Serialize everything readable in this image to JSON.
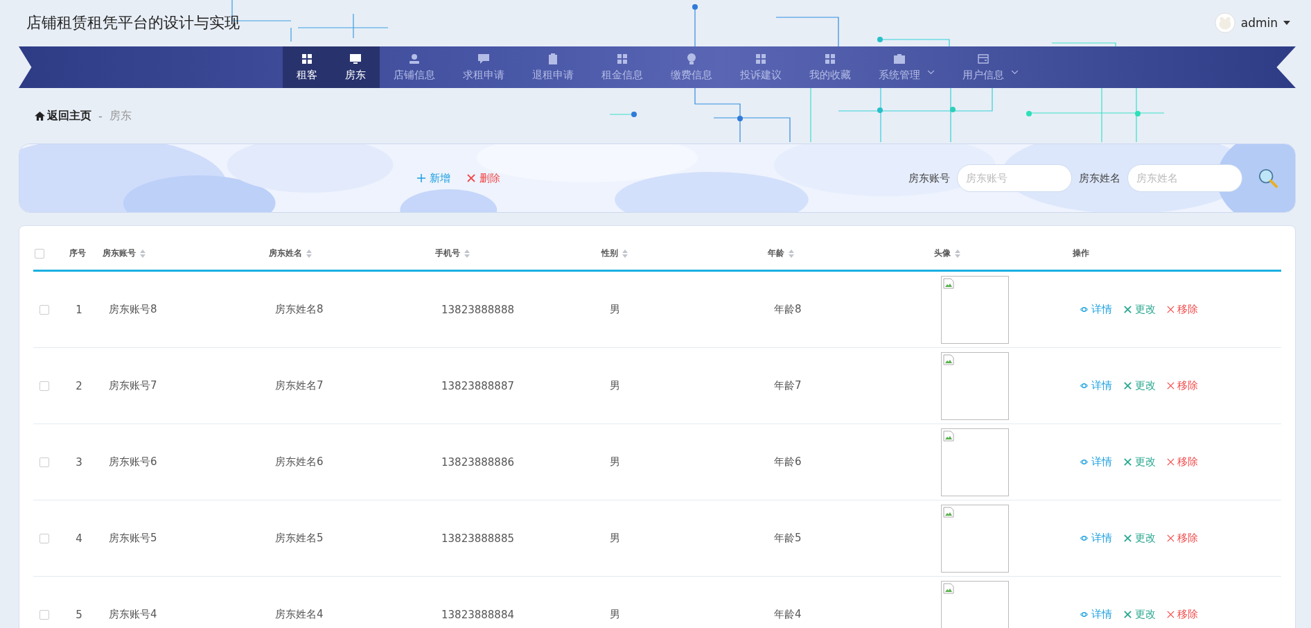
{
  "header": {
    "title": "店铺租赁租凭平台的设计与实现",
    "user": {
      "name": "admin"
    }
  },
  "nav": [
    {
      "label": "租客",
      "kind": "grid",
      "selected": true,
      "has_dropdown": false
    },
    {
      "label": "房东",
      "kind": "monitor",
      "selected": true,
      "has_dropdown": false
    },
    {
      "label": "店铺信息",
      "kind": "user",
      "selected": false,
      "has_dropdown": false
    },
    {
      "label": "求租申请",
      "kind": "chat",
      "selected": false,
      "has_dropdown": false
    },
    {
      "label": "退租申请",
      "kind": "clipboard",
      "selected": false,
      "has_dropdown": false
    },
    {
      "label": "租金信息",
      "kind": "grid",
      "selected": false,
      "has_dropdown": false
    },
    {
      "label": "缴费信息",
      "kind": "bulb",
      "selected": false,
      "has_dropdown": false
    },
    {
      "label": "投诉建议",
      "kind": "grid",
      "selected": false,
      "has_dropdown": false
    },
    {
      "label": "我的收藏",
      "kind": "grid",
      "selected": false,
      "has_dropdown": false
    },
    {
      "label": "系统管理",
      "kind": "briefcase",
      "selected": false,
      "has_dropdown": true
    },
    {
      "label": "用户信息",
      "kind": "card",
      "selected": false,
      "has_dropdown": true
    }
  ],
  "breadcrumb": {
    "home": "返回主页",
    "separator": "-",
    "current": "房东"
  },
  "toolbar": {
    "add": "新增",
    "delete": "删除",
    "filters": [
      {
        "label": "房东账号",
        "placeholder": "房东账号"
      },
      {
        "label": "房东姓名",
        "placeholder": "房东姓名"
      }
    ]
  },
  "table": {
    "all_checked": false,
    "columns": [
      {
        "label": "序号",
        "sortable": false
      },
      {
        "label": "房东账号",
        "sortable": true
      },
      {
        "label": "房东姓名",
        "sortable": true
      },
      {
        "label": "手机号",
        "sortable": true
      },
      {
        "label": "性别",
        "sortable": true
      },
      {
        "label": "年龄",
        "sortable": true
      },
      {
        "label": "头像",
        "sortable": true
      },
      {
        "label": "操作",
        "sortable": false
      }
    ],
    "rows": [
      {
        "checked": false,
        "index": "1",
        "account": "房东账号8",
        "name": "房东姓名8",
        "phone": "13823888888",
        "gender": "男",
        "age": "年龄8",
        "actions": {
          "detail": "详情",
          "edit": "更改",
          "remove": "移除"
        }
      },
      {
        "checked": false,
        "index": "2",
        "account": "房东账号7",
        "name": "房东姓名7",
        "phone": "13823888887",
        "gender": "男",
        "age": "年龄7",
        "actions": {
          "detail": "详情",
          "edit": "更改",
          "remove": "移除"
        }
      },
      {
        "checked": false,
        "index": "3",
        "account": "房东账号6",
        "name": "房东姓名6",
        "phone": "13823888886",
        "gender": "男",
        "age": "年龄6",
        "actions": {
          "detail": "详情",
          "edit": "更改",
          "remove": "移除"
        }
      },
      {
        "checked": false,
        "index": "4",
        "account": "房东账号5",
        "name": "房东姓名5",
        "phone": "13823888885",
        "gender": "男",
        "age": "年龄5",
        "actions": {
          "detail": "详情",
          "edit": "更改",
          "remove": "移除"
        }
      },
      {
        "checked": false,
        "index": "5",
        "account": "房东账号4",
        "name": "房东姓名4",
        "phone": "13823888884",
        "gender": "男",
        "age": "年龄4",
        "actions": {
          "detail": "详情",
          "edit": "更改",
          "remove": "移除"
        }
      }
    ]
  }
}
